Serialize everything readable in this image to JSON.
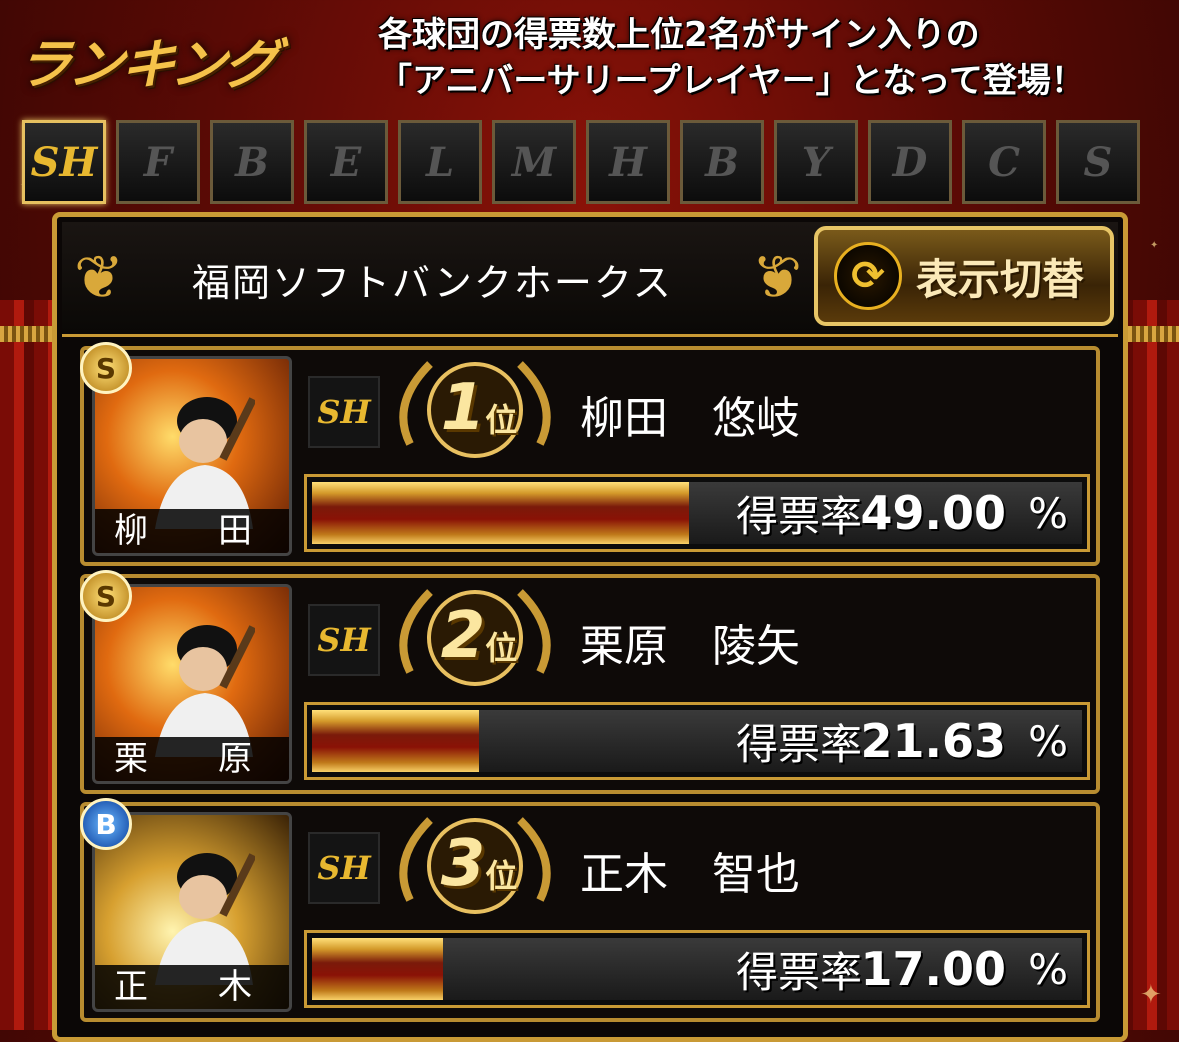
{
  "header": {
    "title": "ランキング",
    "notice_line1": "各球団の得票数上位2名がサイン入りの",
    "notice_line2": "「アニバーサリープレイヤー」となって登場！"
  },
  "tabs": [
    {
      "label": "SH",
      "name": "softbank",
      "active": true
    },
    {
      "label": "F",
      "name": "fighters",
      "active": false
    },
    {
      "label": "B",
      "name": "buffaloes",
      "active": false
    },
    {
      "label": "E",
      "name": "eagles",
      "active": false
    },
    {
      "label": "L",
      "name": "lions",
      "active": false
    },
    {
      "label": "M",
      "name": "marines",
      "active": false
    },
    {
      "label": "H",
      "name": "tigers",
      "active": false
    },
    {
      "label": "B",
      "name": "baystars",
      "active": false
    },
    {
      "label": "Y",
      "name": "giants",
      "active": false
    },
    {
      "label": "D",
      "name": "dragons",
      "active": false
    },
    {
      "label": "C",
      "name": "carp",
      "active": false
    },
    {
      "label": "S",
      "name": "swallows",
      "active": false
    }
  ],
  "team_bar": {
    "team_name": "福岡ソフトバンクホークス",
    "switch_label": "表示切替"
  },
  "rankings": [
    {
      "rank": "1",
      "rank_suffix": "位",
      "rarity": "S",
      "card_name": "柳　田",
      "player_name": "柳田　悠岐",
      "team_icon": "SH",
      "rate_label": "得票率",
      "rate_value": "49.00",
      "rate_unit": "%",
      "rate": 49.0
    },
    {
      "rank": "2",
      "rank_suffix": "位",
      "rarity": "S",
      "card_name": "栗　原",
      "player_name": "栗原　陵矢",
      "team_icon": "SH",
      "rate_label": "得票率",
      "rate_value": "21.63",
      "rate_unit": "%",
      "rate": 21.63
    },
    {
      "rank": "3",
      "rank_suffix": "位",
      "rarity": "B",
      "card_name": "正　木",
      "player_name": "正木　智也",
      "team_icon": "SH",
      "rate_label": "得票率",
      "rate_value": "17.00",
      "rate_unit": "%",
      "rate": 17.0
    }
  ],
  "colors": {
    "accent_gold": "#c99a35",
    "bg_red": "#5a0a05",
    "rarity_s": "#e0a820",
    "rarity_b": "#1a5ad0"
  }
}
